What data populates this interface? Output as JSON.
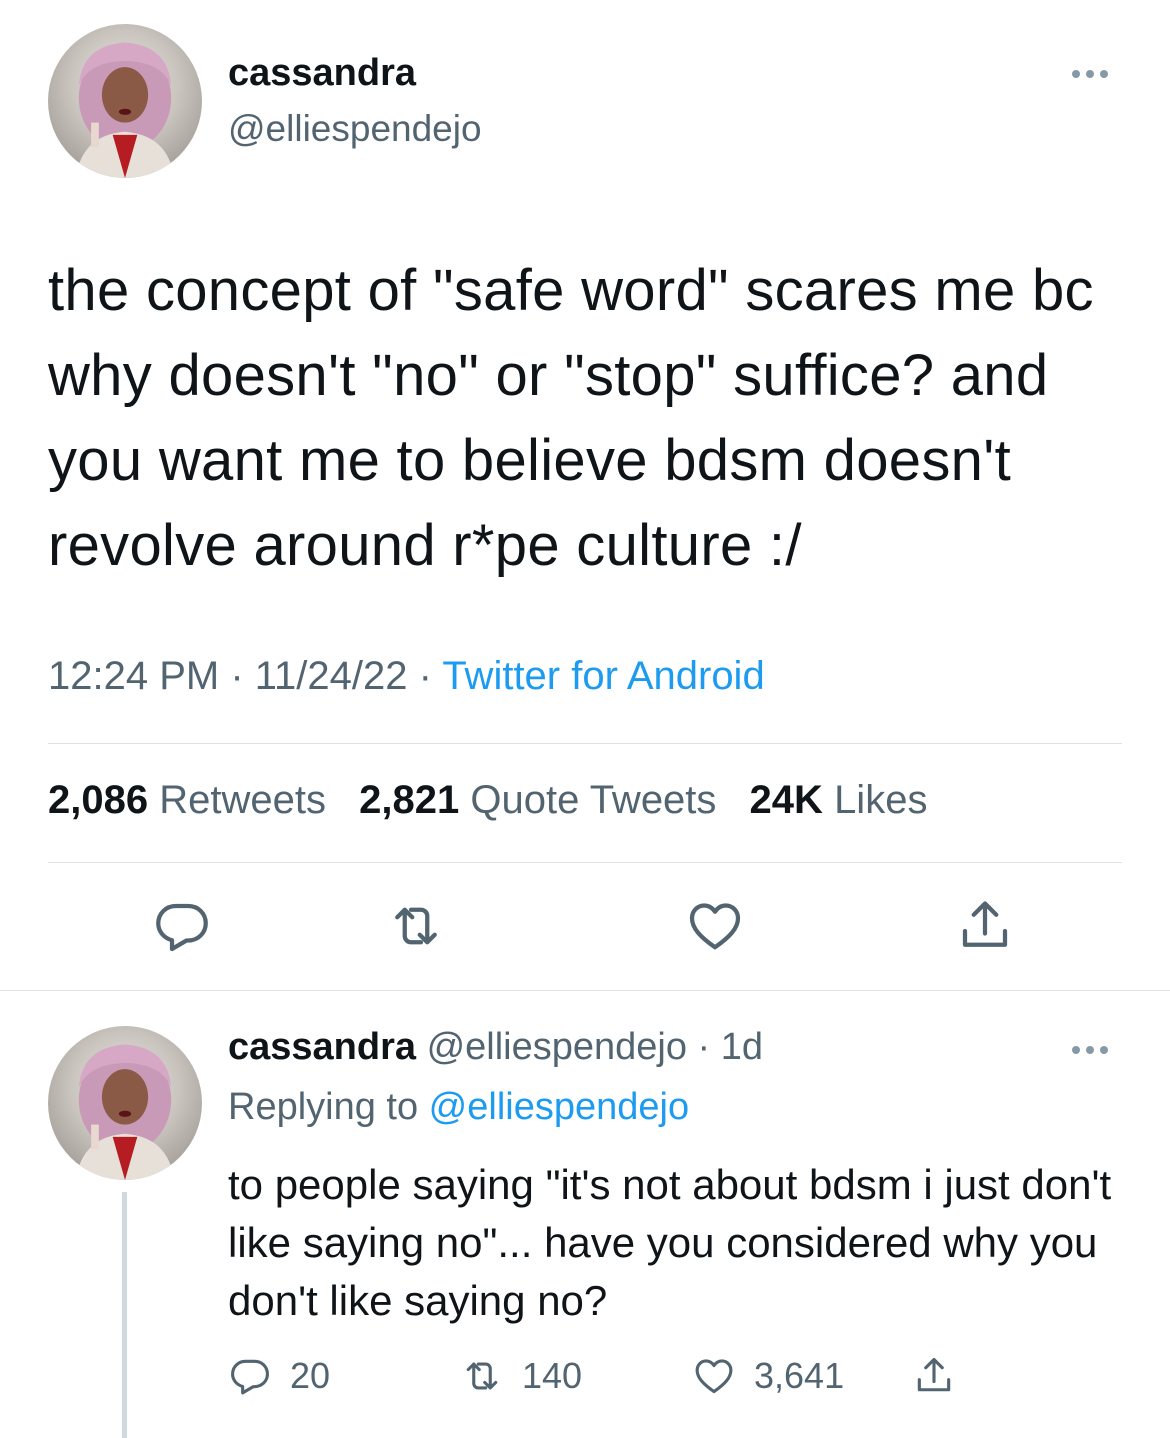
{
  "main_tweet": {
    "author_name": "cassandra",
    "author_handle": "@elliespendejo",
    "text": "the concept of \"safe word\" scares me bc why doesn't \"no\" or \"stop\" suffice? and you want me to believe bdsm doesn't revolve around r*pe culture :/",
    "time": "12:24 PM",
    "date": "11/24/22",
    "separator": " · ",
    "source": "Twitter for Android",
    "stats": {
      "retweets_count": "2,086",
      "retweets_label": "Retweets",
      "quotes_count": "2,821",
      "quotes_label": "Quote Tweets",
      "likes_count": "24K",
      "likes_label": "Likes"
    },
    "actions": [
      "reply-icon",
      "retweet-icon",
      "heart-icon",
      "share-icon"
    ]
  },
  "reply_tweet": {
    "author_name": "cassandra",
    "author_handle": "@elliespendejo",
    "age": "1d",
    "separator": " · ",
    "replying_label": "Replying to ",
    "replying_to": "@elliespendejo",
    "text": "to people saying \"it's not about bdsm i just don't like saying no\"... have you considered why you don't like saying no?",
    "reply_count": "20",
    "retweet_count": "140",
    "like_count": "3,641"
  },
  "colors": {
    "text": "#0f1419",
    "secondary": "#536471",
    "link": "#1d9bf0",
    "icon": "#536471"
  }
}
